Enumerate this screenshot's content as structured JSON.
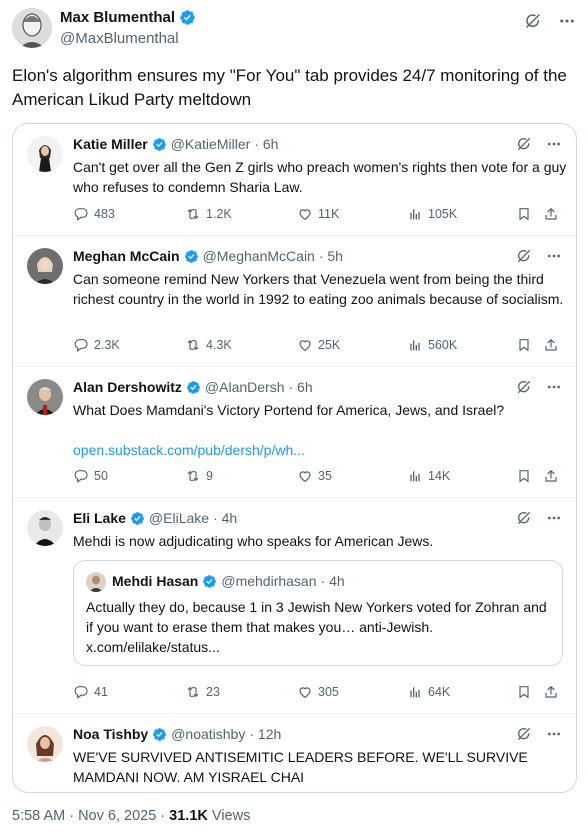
{
  "post": {
    "author_name": "Max Blumenthal",
    "author_handle": "@MaxBlumenthal",
    "text": "Elon's algorithm ensures my \"For You\" tab provides 24/7 monitoring of the American Likud Party meltdown",
    "timestamp": "5:58 AM · Nov 6, 2025 · ",
    "views_count": "31.1K",
    "views_label": " Views"
  },
  "icons": {
    "grok": "grok-icon",
    "more": "more-icon",
    "verified": "verified-badge-icon",
    "reply": "reply-icon",
    "retweet": "retweet-icon",
    "like": "like-icon",
    "views": "views-icon",
    "bookmark": "bookmark-icon",
    "share": "share-icon"
  },
  "colors": {
    "verified": "#1d9bf0",
    "link": "#1d9bf0",
    "muted": "#536471",
    "text": "#0f1419"
  },
  "quoted": [
    {
      "name": "Katie Miller",
      "handle": "@KatieMiller",
      "time": "· 6h",
      "text": "Can't get over all the Gen Z girls who preach women's rights then vote for a guy who refuses to condemn Sharia Law.",
      "replies": "483",
      "reposts": "1.2K",
      "likes": "11K",
      "views": "105K"
    },
    {
      "name": "Meghan McCain",
      "handle": "@MeghanMcCain",
      "time": "· 5h",
      "text": "Can someone remind New Yorkers that Venezuela went from being the third richest country in the world in 1992 to eating zoo animals because of socialism.",
      "replies": "2.3K",
      "reposts": "4.3K",
      "likes": "25K",
      "views": "560K"
    },
    {
      "name": "Alan Dershowitz",
      "handle": "@AlanDersh",
      "time": "· 6h",
      "text": "What Does Mamdani's Victory Portend for America, Jews, and Israel?",
      "link": "open.substack.com/pub/dersh/p/wh...",
      "replies": "50",
      "reposts": "9",
      "likes": "35",
      "views": "14K"
    },
    {
      "name": "Eli Lake",
      "handle": "@EliLake",
      "time": "· 4h",
      "text": "Mehdi is now adjudicating who speaks for American Jews.",
      "nested": {
        "name": "Mehdi Hasan",
        "handle": "@mehdirhasan",
        "time": "· 4h",
        "text": "Actually they do, because 1 in 3 Jewish New Yorkers voted for Zohran and if you want to erase them that makes you… anti-Jewish.",
        "link": "x.com/elilake/status..."
      },
      "replies": "41",
      "reposts": "23",
      "likes": "305",
      "views": "64K"
    },
    {
      "name": "Noa Tishby",
      "handle": "@noatishby",
      "time": "· 12h",
      "text": "WE'VE SURVIVED ANTISEMITIC LEADERS BEFORE. WE'LL SURVIVE MAMDANI NOW. AM YISRAEL CHAI"
    }
  ]
}
